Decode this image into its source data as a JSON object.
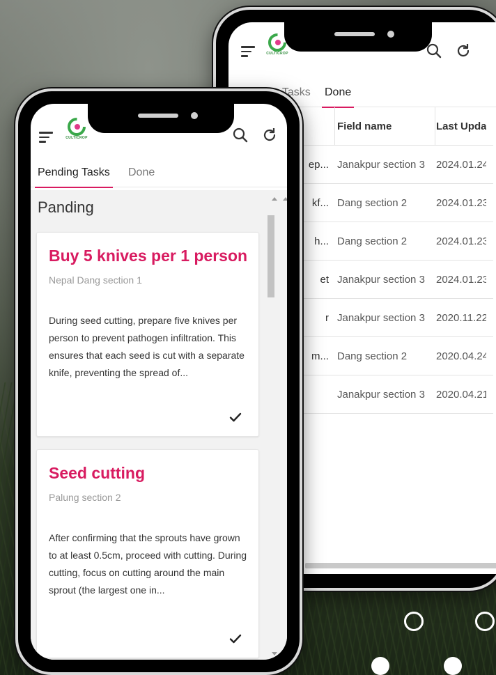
{
  "colors": {
    "accent": "#d81b60",
    "logo_green": "#3aa84a",
    "text_dark": "#333333",
    "text_muted": "#999999"
  },
  "brand": {
    "logo_text": "CULTICROP"
  },
  "tabs": {
    "pending": "Pending Tasks",
    "done": "Done"
  },
  "back_screen": {
    "columns": {
      "field": "Field name",
      "updated": "Last Updat"
    },
    "rows": [
      {
        "name": "ep...",
        "field": "Janakpur section 3",
        "date": "2024.01.24"
      },
      {
        "name": "kf...",
        "field": "Dang section 2",
        "date": "2024.01.23"
      },
      {
        "name": "h...",
        "field": "Dang section 2",
        "date": "2024.01.23"
      },
      {
        "name": "et",
        "field": "Janakpur section 3",
        "date": "2024.01.23"
      },
      {
        "name": "r",
        "field": "Janakpur section 3",
        "date": "2020.11.22"
      },
      {
        "name": "m...",
        "field": "Dang section 2",
        "date": "2020.04.24"
      },
      {
        "name": "",
        "field": "Janakpur section 3",
        "date": "2020.04.21"
      }
    ]
  },
  "front_screen": {
    "section_title": "Panding",
    "cards": [
      {
        "title": "Buy 5 knives per 1 person",
        "location": "Nepal Dang section 1",
        "description": "During seed cutting, prepare five knives per person to prevent pathogen infiltration. This ensures that each seed is cut with a separate knife, preventing the spread of..."
      },
      {
        "title": "Seed cutting",
        "location": "Palung section 2",
        "description": "After confirming that the sprouts have grown to at least 0.5cm, proceed with cutting. During cutting, focus on cutting around the main sprout (the largest one in..."
      }
    ]
  },
  "icons": {
    "menu": "menu-icon",
    "search": "search-icon",
    "refresh": "refresh-icon",
    "check": "check-icon"
  }
}
